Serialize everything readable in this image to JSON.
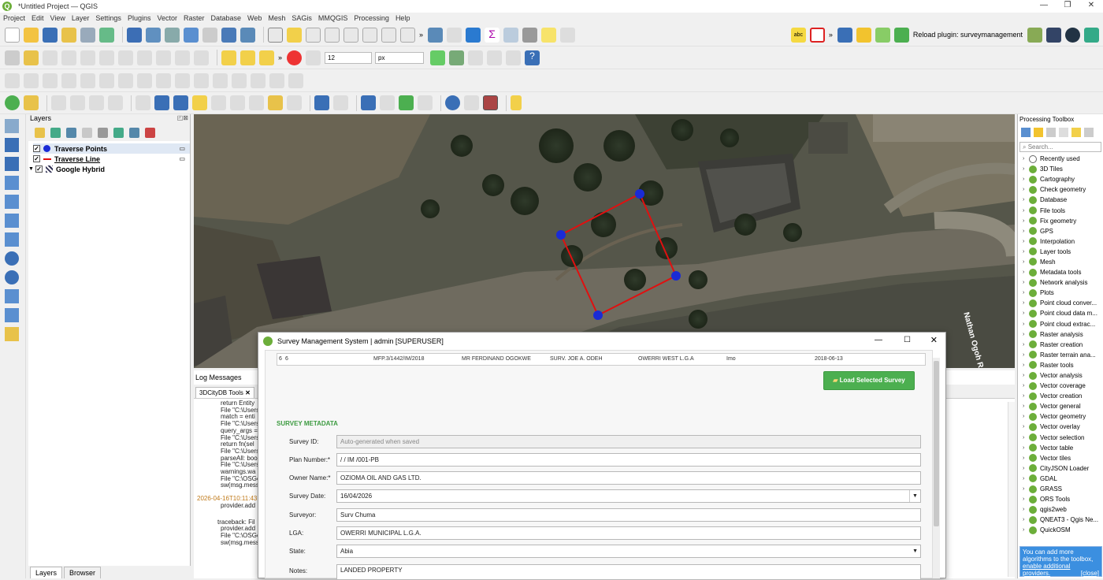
{
  "window": {
    "title": "*Untitled Project — QGIS",
    "logo": "Q"
  },
  "menu": [
    "Project",
    "Edit",
    "View",
    "Layer",
    "Settings",
    "Plugins",
    "Vector",
    "Raster",
    "Database",
    "Web",
    "Mesh",
    "SAGis",
    "MMQGIS",
    "Processing",
    "Help"
  ],
  "toolbar": {
    "reload_plugin_label": "Reload plugin: surveymanagement",
    "font_size_value": "12",
    "unit_value": "px",
    "abc_label": "abc"
  },
  "layers_panel": {
    "title": "Layers",
    "items": [
      {
        "name": "Traverse Points",
        "checked": "✓"
      },
      {
        "name": "Traverse Line",
        "checked": "✓"
      },
      {
        "name": "Google Hybrid",
        "checked": "✓"
      }
    ],
    "tabs": [
      "Layers",
      "Browser"
    ]
  },
  "map": {
    "road_label": "Nathan Ogoh R",
    "traverse_color": "#e01010",
    "point_color": "#1a2bd6"
  },
  "log_panel": {
    "title": "Log Messages",
    "tab": "3DCityDB Tools",
    "lines": [
      "return Entity",
      "File \"C:\\Users",
      "match = enti",
      "File \"C:\\Users",
      "query_args =",
      "File \"C:\\Users",
      "return fn(sel",
      "File \"C:\\Users",
      "parseAll: boo",
      "File \"C:\\Users",
      "warnings.wa",
      "File \"C:\\OSGe",
      "sw(msg.mess"
    ],
    "timestamp": "2026-04-16T10:11:43",
    "lines2": [
      "provider.add"
    ],
    "lines3": [
      "traceback: Fil",
      "provider.add",
      "File \"C:\\OSGe",
      "sw(msg.mess"
    ]
  },
  "toolbox": {
    "title": "Processing Toolbox",
    "search_placeholder": "Search...",
    "items": [
      "Recently used",
      "3D Tiles",
      "Cartography",
      "Check geometry",
      "Database",
      "File tools",
      "Fix geometry",
      "GPS",
      "Interpolation",
      "Layer tools",
      "Mesh",
      "Metadata tools",
      "Network analysis",
      "Plots",
      "Point cloud conver...",
      "Point cloud data m...",
      "Point cloud extrac...",
      "Raster analysis",
      "Raster creation",
      "Raster terrain ana...",
      "Raster tools",
      "Vector analysis",
      "Vector coverage",
      "Vector creation",
      "Vector general",
      "Vector geometry",
      "Vector overlay",
      "Vector selection",
      "Vector table",
      "Vector tiles",
      "CityJSON Loader",
      "GDAL",
      "GRASS",
      "ORS Tools",
      "qgis2web",
      "QNEAT3 - Qgis Ne...",
      "QuickOSM"
    ],
    "info_text": "You can add more algorithms to the toolbox,",
    "info_link": "enable additional providers.",
    "info_close": "[close]"
  },
  "dialog": {
    "title": "Survey Management System  |  admin  [SUPERUSER]",
    "table_row": [
      "6",
      "6",
      "MFP.3/1442/IM/2018",
      "MR FERDINAND OGOKWE",
      "SURV. JOE A. ODEH",
      "OWERRI WEST L.G.A",
      "Imo",
      "2018-06-13"
    ],
    "load_button": "Load Selected Survey",
    "section_title": "SURVEY METADATA",
    "fields": {
      "survey_id_label": "Survey ID:",
      "survey_id_placeholder": "Auto-generated when saved",
      "plan_number_label": "Plan Number:*",
      "plan_number_value": "/ / IM /001-PB",
      "owner_name_label": "Owner Name:*",
      "owner_name_value": "OZIOMA OIL AND GAS LTD.",
      "survey_date_label": "Survey Date:",
      "survey_date_value": "16/04/2026",
      "surveyor_label": "Surveyor:",
      "surveyor_value": "Surv Chuma",
      "lga_label": "LGA:",
      "lga_value": "OWERRI MUNICIPAL L.G.A.",
      "state_label": "State:",
      "state_value": "Abia",
      "notes_label": "Notes:",
      "notes_value": "LANDED PROPERTY"
    },
    "accent_color": "#4caf50"
  }
}
